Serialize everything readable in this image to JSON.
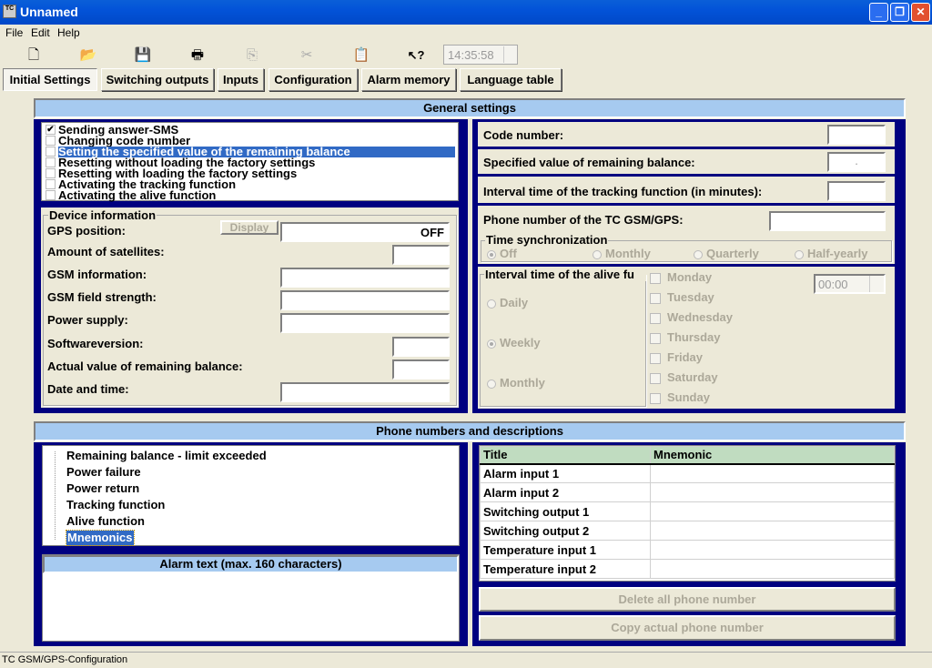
{
  "window": {
    "title": "Unnamed",
    "app_icon": "tc-app-icon",
    "controls": {
      "minimize": "_",
      "restore": "❐",
      "close": "✕"
    }
  },
  "menu": [
    "File",
    "Edit",
    "Help"
  ],
  "toolbar": {
    "icons": [
      {
        "name": "new-file-icon",
        "glyph": "🗋",
        "enabled": true
      },
      {
        "name": "open-folder-icon",
        "glyph": "📂",
        "enabled": true
      },
      {
        "name": "save-icon",
        "glyph": "💾",
        "enabled": true
      },
      {
        "name": "print-icon",
        "glyph": "🖶",
        "enabled": true
      },
      {
        "name": "copy-icon",
        "glyph": "⎘",
        "enabled": false
      },
      {
        "name": "cut-icon",
        "glyph": "✂",
        "enabled": false
      },
      {
        "name": "paste-icon",
        "glyph": "📋",
        "enabled": false
      },
      {
        "name": "context-help-icon",
        "glyph": "↖?",
        "enabled": true
      }
    ],
    "time": "14:35:58"
  },
  "tabs": [
    "Initial Settings",
    "Switching outputs",
    "Inputs",
    "Configuration",
    "Alarm memory",
    "Language table"
  ],
  "active_tab": "Initial Settings",
  "general": {
    "header": "General settings",
    "sms_options": [
      {
        "label": "Sending answer-SMS",
        "checked": true
      },
      {
        "label": "Changing code number",
        "checked": false
      },
      {
        "label": "Setting the specified value of the remaining balance",
        "checked": false,
        "selected": true
      },
      {
        "label": "Resetting without loading the factory settings",
        "checked": false
      },
      {
        "label": "Resetting with loading the factory settings",
        "checked": false
      },
      {
        "label": "Activating the tracking function",
        "checked": false
      },
      {
        "label": "Activating the alive function",
        "checked": false
      }
    ],
    "device": {
      "title": "Device information",
      "display_button": "Display",
      "gps_position_label": "GPS position:",
      "gps_position_value": "OFF",
      "satellites_label": "Amount of satellites:",
      "gsm_info_label": "GSM information:",
      "gsm_field_label": "GSM field strength:",
      "power_supply_label": "Power supply:",
      "software_label": "Softwareversion:",
      "balance_label": "Actual value of remaining balance:",
      "datetime_label": "Date and time:"
    },
    "code_number_label": "Code number:",
    "specified_balance_label": "Specified value of remaining balance:",
    "specified_balance_value": ".",
    "tracking_interval_label": "Interval time of the tracking function (in minutes):",
    "phone_label": "Phone number of the TC GSM/GPS:",
    "time_sync": {
      "title": "Time synchronization",
      "options": [
        "Off",
        "Monthly",
        "Quarterly",
        "Half-yearly"
      ],
      "selected": "Off"
    },
    "alive": {
      "title": "Interval time of the alive fu",
      "options": [
        "Daily",
        "Weekly",
        "Monthly"
      ],
      "selected": "Weekly",
      "days": [
        "Monday",
        "Tuesday",
        "Wednesday",
        "Thursday",
        "Friday",
        "Saturday",
        "Sunday"
      ],
      "time": "00:00"
    }
  },
  "phones": {
    "header": "Phone numbers and descriptions",
    "tree": [
      "Remaining balance - limit exceeded",
      "Power failure",
      "Power return",
      "Tracking function",
      "Alive function",
      "Mnemonics"
    ],
    "tree_selected": "Mnemonics",
    "alarm_text_header": "Alarm text (max. 160 characters)",
    "table": {
      "columns": [
        "Title",
        "Mnemonic"
      ],
      "rows": [
        [
          "Alarm input 1",
          ""
        ],
        [
          "Alarm input 2",
          ""
        ],
        [
          "Switching output 1",
          ""
        ],
        [
          "Switching output 2",
          ""
        ],
        [
          "Temperature input 1",
          ""
        ],
        [
          "Temperature input 2",
          ""
        ]
      ]
    },
    "delete_button": "Delete all phone number",
    "copy_button": "Copy actual phone number"
  },
  "status": "TC GSM/GPS-Configuration"
}
